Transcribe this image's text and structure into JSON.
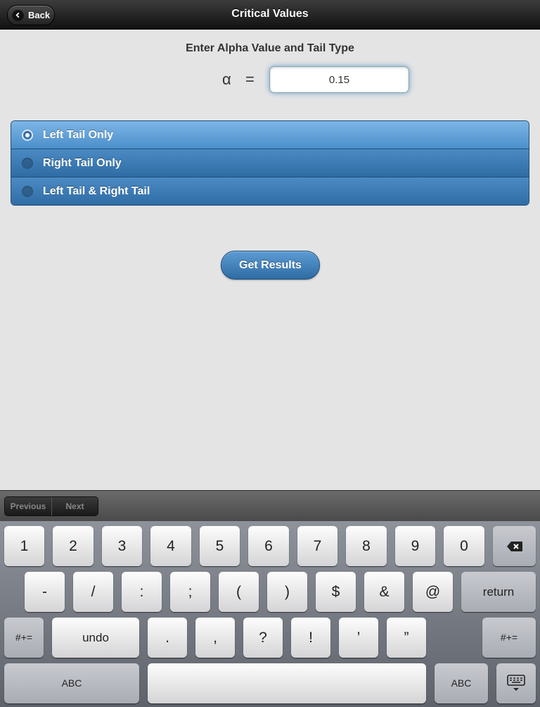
{
  "header": {
    "title": "Critical Values",
    "back_label": "Back"
  },
  "main": {
    "prompt": "Enter Alpha Value and Tail Type",
    "alpha_symbol": "α",
    "equals_symbol": "=",
    "alpha_value": "0.15",
    "tail_options": [
      {
        "label": "Left Tail Only",
        "selected": true
      },
      {
        "label": "Right Tail Only",
        "selected": false
      },
      {
        "label": "Left Tail & Right Tail",
        "selected": false
      }
    ],
    "results_button": "Get Results"
  },
  "accessory": {
    "previous": "Previous",
    "next": "Next"
  },
  "keyboard": {
    "row1": [
      "1",
      "2",
      "3",
      "4",
      "5",
      "6",
      "7",
      "8",
      "9",
      "0"
    ],
    "row2": [
      "-",
      "/",
      ":",
      ";",
      "(",
      ")",
      "$",
      "&",
      "@"
    ],
    "return": "return",
    "symbols": "#+=",
    "undo": "undo",
    "row3": [
      ".",
      ",",
      "?",
      "!",
      "’",
      "”"
    ],
    "abc": "ABC",
    "icons": {
      "backspace": "backspace-icon",
      "dismiss": "keyboard-dismiss-icon"
    }
  }
}
